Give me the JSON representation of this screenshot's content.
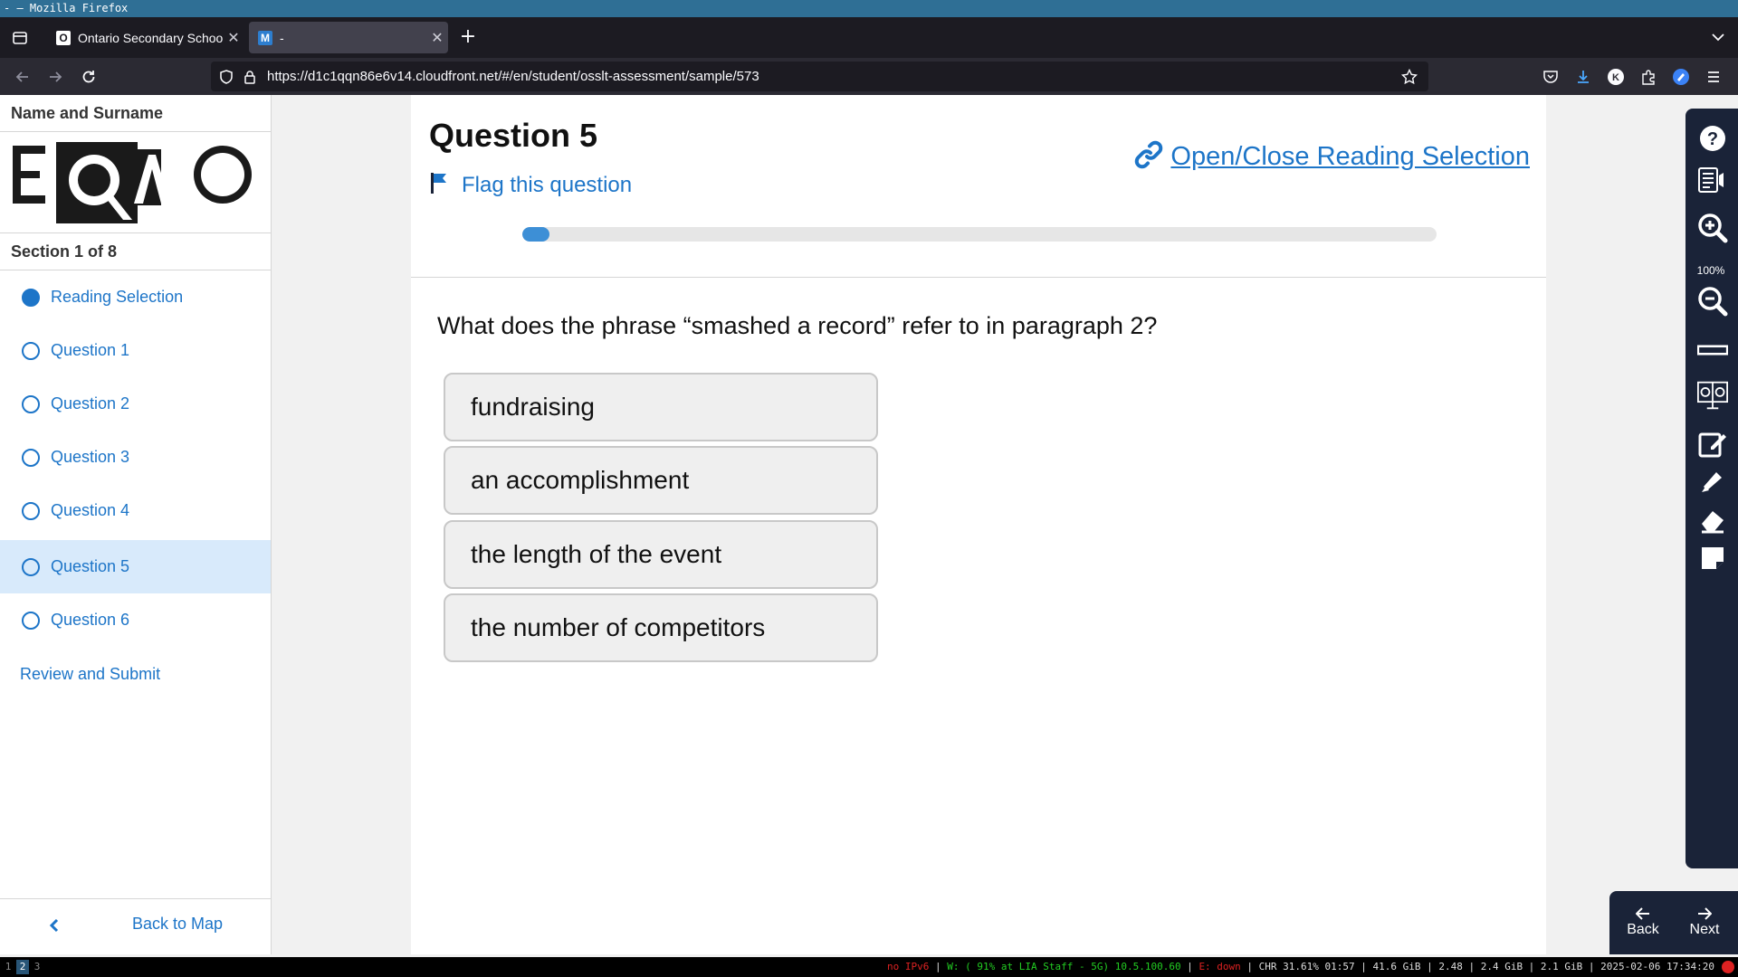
{
  "os": {
    "window_title": "- — Mozilla Firefox"
  },
  "browser": {
    "tabs": [
      {
        "label": "Ontario Secondary School",
        "favicon": "O",
        "active": false
      },
      {
        "label": "-",
        "favicon": "M",
        "active": true
      }
    ],
    "url": "https://d1c1qqn86e6v14.cloudfront.net/#/en/student/osslt-assessment/sample/573"
  },
  "sidebar": {
    "user_name": "Name and Surname",
    "logo_text": "EQAO",
    "section": "Section 1 of 8",
    "items": [
      {
        "label": "Reading Selection",
        "state": "done"
      },
      {
        "label": "Question 1",
        "state": "open"
      },
      {
        "label": "Question 2",
        "state": "open"
      },
      {
        "label": "Question 3",
        "state": "open"
      },
      {
        "label": "Question 4",
        "state": "open"
      },
      {
        "label": "Question 5",
        "state": "current"
      },
      {
        "label": "Question 6",
        "state": "open"
      }
    ],
    "review_label": "Review and Submit",
    "back_label": "Back to Map"
  },
  "main": {
    "title": "Question 5",
    "flag_label": "Flag this question",
    "reading_toggle_label": "Open/Close Reading Selection",
    "progress_fraction": 0.03,
    "question": "What does the phrase “smashed a record” refer to in paragraph 2?",
    "options": [
      "fundraising",
      "an accomplishment",
      "the length of the event",
      "the number of competitors"
    ]
  },
  "toolbar": {
    "zoom_level": "100%",
    "tools": [
      "help-icon",
      "text-to-speech-icon",
      "zoom-in-icon",
      "zoom-out-icon",
      "line-reader-icon",
      "notepad-toggle-icon",
      "edit-icon",
      "highlighter-icon",
      "eraser-icon",
      "sticky-note-icon"
    ]
  },
  "pager": {
    "back_label": "Back",
    "next_label": "Next"
  },
  "statusbar": {
    "workspaces": [
      "1",
      "2",
      "3"
    ],
    "ipv6": "no IPv6",
    "wifi": "W: ( 91% at LIA Staff - 5G) 10.5.100.60",
    "ethernet": "E: down",
    "stats": "CHR 31.61% 01:57 | 41.6 GiB | 2.48 | 2.4 GiB | 2.1 GiB | 2025-02-06 17:34:20"
  },
  "colors": {
    "accent": "#1d75c8",
    "toolbar_bg": "#1a2338",
    "active_item_bg": "#d8eafb"
  }
}
